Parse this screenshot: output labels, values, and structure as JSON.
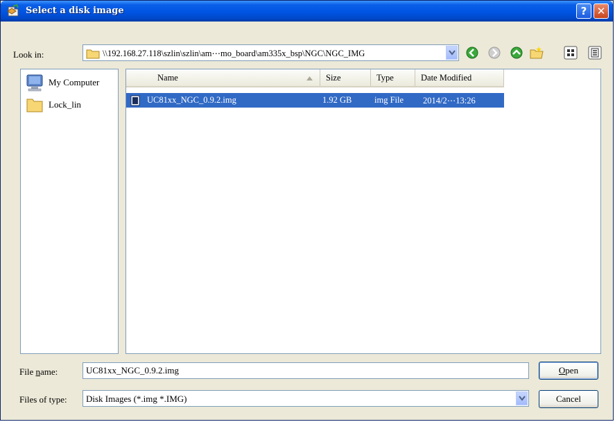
{
  "window": {
    "title": "Select a disk image",
    "help_label": "?",
    "close_label": "✕"
  },
  "look_in": {
    "label": "Look in:",
    "path": "\\\\192.168.27.118\\szlin\\szlin\\am⋯mo_board\\am335x_bsp\\NGC\\NGC_IMG"
  },
  "toolbar": {
    "icons": [
      "back-icon",
      "forward-icon",
      "up-folder-icon",
      "new-folder-icon",
      "view-menu-icon",
      "view-details-icon"
    ]
  },
  "places": [
    {
      "label": "My Computer",
      "icon": "my-computer-icon"
    },
    {
      "label": "Lock_lin",
      "icon": "folder-icon"
    }
  ],
  "file_list": {
    "columns": [
      "Name",
      "Size",
      "Type",
      "Date Modified"
    ],
    "rows": [
      {
        "name": "UC81xx_NGC_0.9.2.img",
        "size": "1.92 GB",
        "type": "img File",
        "modified": "2014/2⋯13:26",
        "selected": true
      }
    ]
  },
  "file_name": {
    "label_pre": "File ",
    "label_accel": "n",
    "label_post": "ame:",
    "value": "UC81xx_NGC_0.9.2.img"
  },
  "file_type": {
    "label": "Files of type:",
    "value": "Disk Images (*.img *.IMG)"
  },
  "buttons": {
    "open_accel": "O",
    "open_rest": "pen",
    "cancel": "Cancel"
  },
  "colors": {
    "title_bar": "#0054e3",
    "selection": "#316ac5",
    "dialog_bg": "#ece9d8"
  }
}
